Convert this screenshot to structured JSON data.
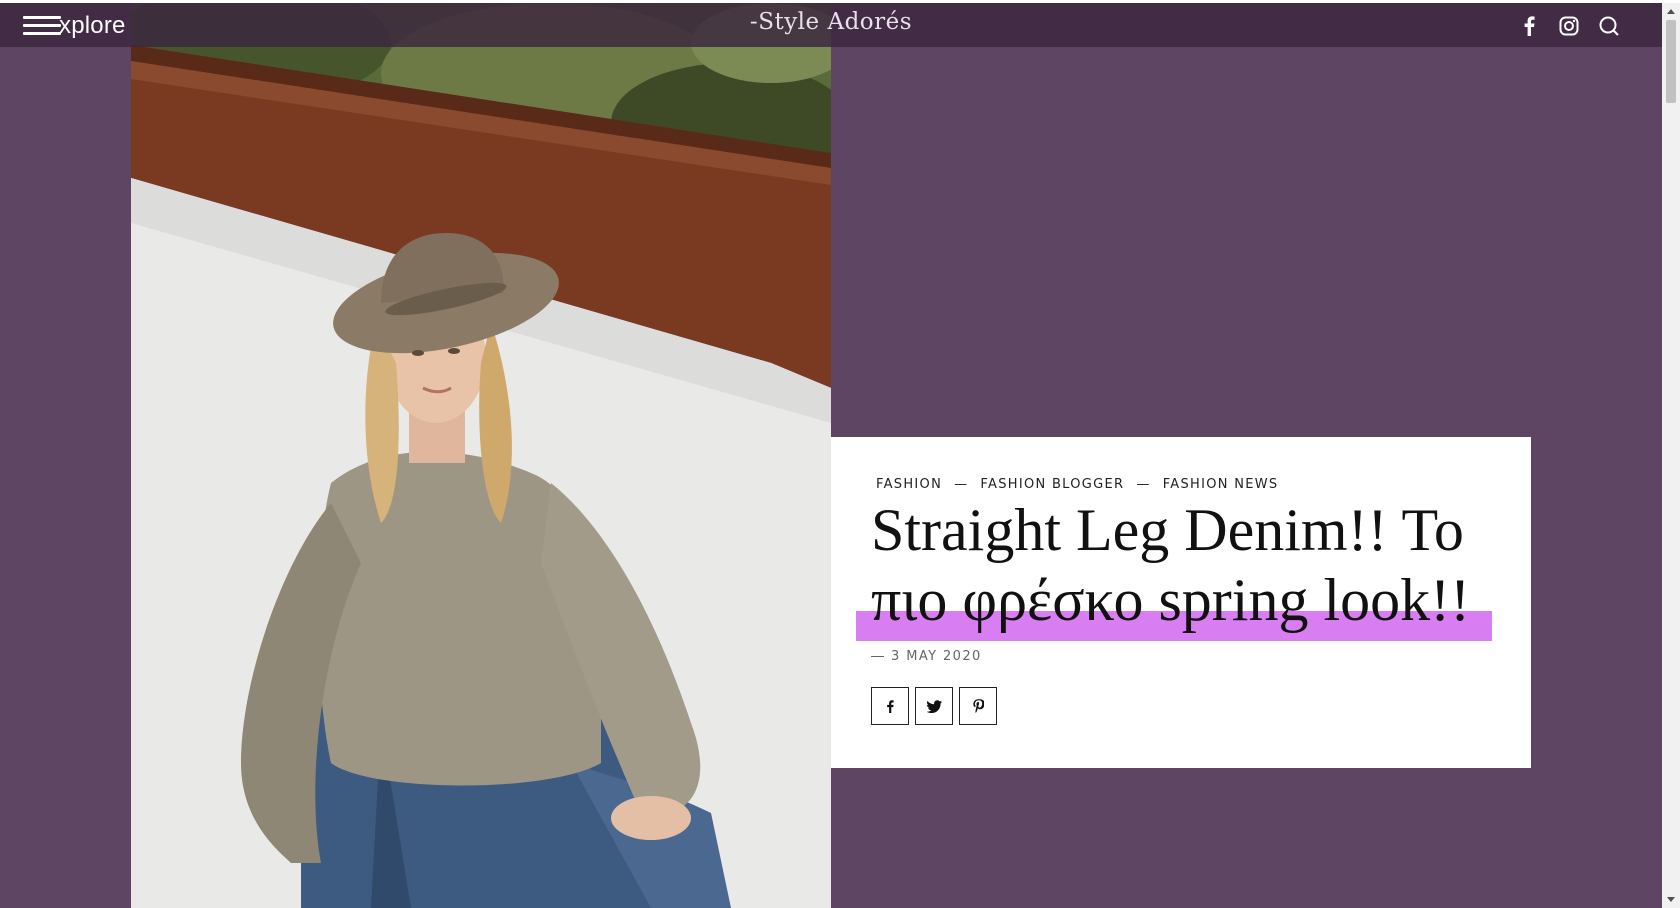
{
  "header": {
    "menu_label": "xplore",
    "logo": "-Style Adorés",
    "icons": [
      "facebook-icon",
      "instagram-icon",
      "search-icon"
    ]
  },
  "article": {
    "categories": [
      "FASHION",
      "FASHION BLOGGER",
      "FASHION NEWS"
    ],
    "title_line1": "Straight Leg Denim!! To",
    "title_line2": "πιο φρέσκο spring look!!",
    "date": "3 MAY 2020",
    "share_icons": [
      "facebook-icon",
      "twitter-icon",
      "pinterest-icon"
    ]
  },
  "colors": {
    "background": "#5d4563",
    "header": "#3a263e",
    "highlight": "#d97ef2",
    "card": "#ffffff"
  }
}
